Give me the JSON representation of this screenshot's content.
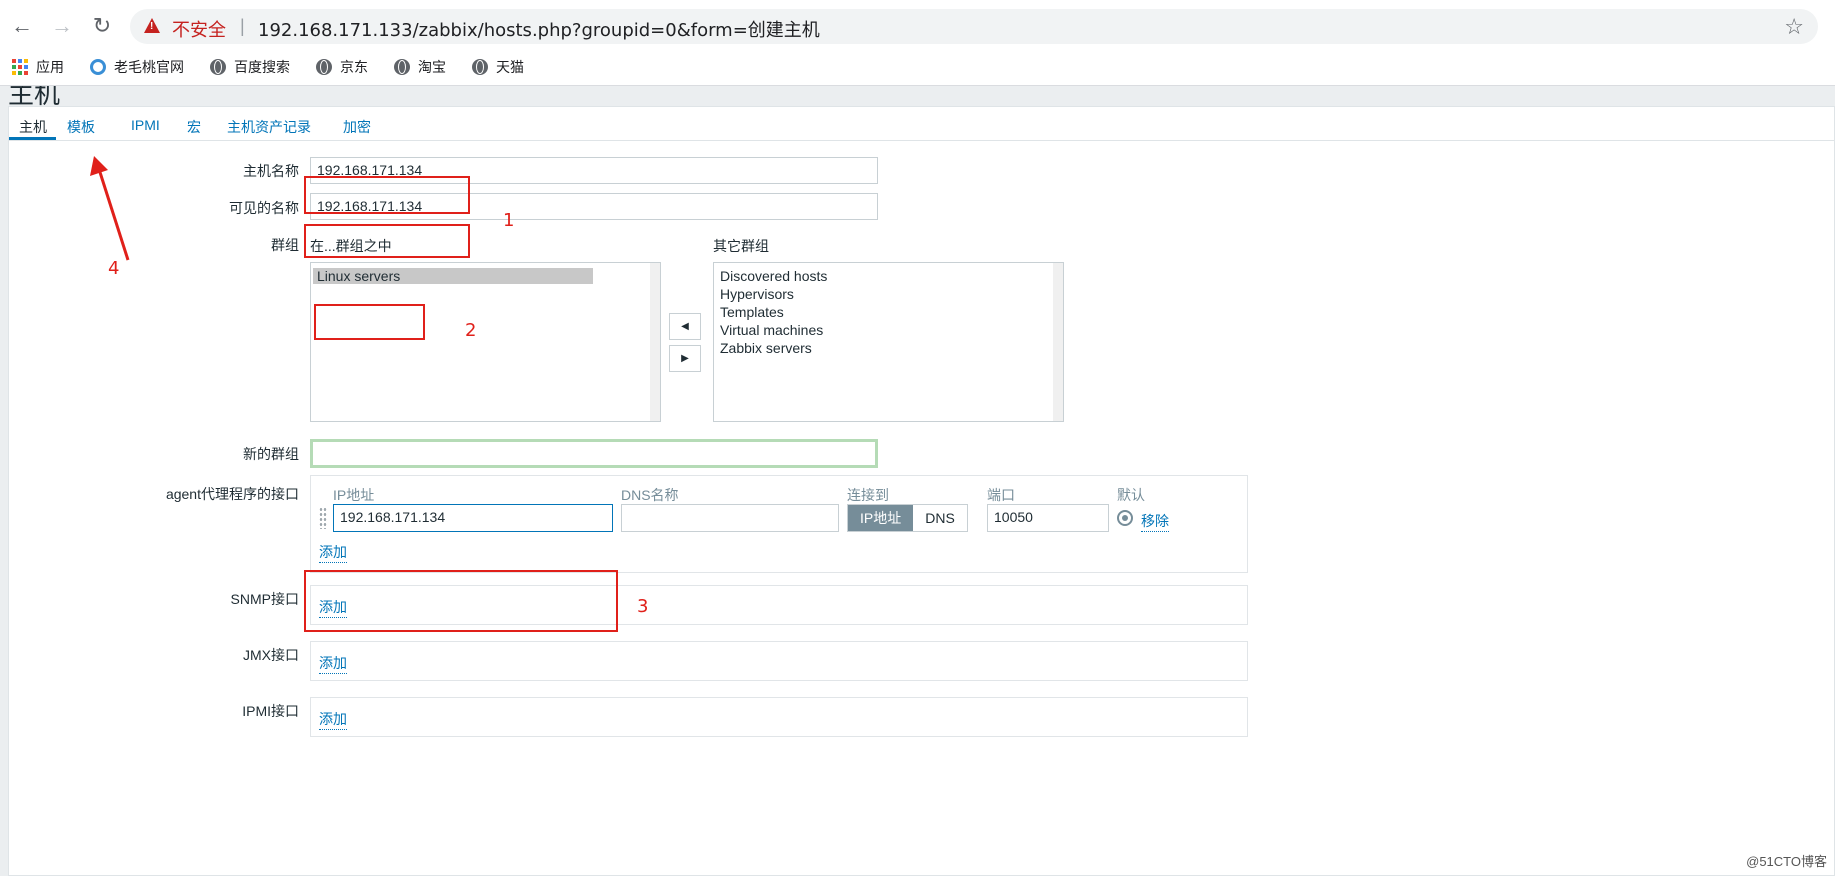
{
  "browser": {
    "back_glyph": "←",
    "forward_glyph": "→",
    "reload_glyph": "↻",
    "security_label": "不安全",
    "separator": "|",
    "url": "192.168.171.133/zabbix/hosts.php?groupid=0&form=创建主机",
    "star_glyph": "☆",
    "bookmarks": [
      {
        "label": "应用",
        "icon": "apps-grid-icon"
      },
      {
        "label": "老毛桃官网",
        "icon": "laomaotao-icon"
      },
      {
        "label": "百度搜索",
        "icon": "globe-icon"
      },
      {
        "label": "京东",
        "icon": "globe-icon"
      },
      {
        "label": "淘宝",
        "icon": "globe-icon"
      },
      {
        "label": "天猫",
        "icon": "globe-icon"
      }
    ]
  },
  "page": {
    "heading": "主机"
  },
  "tabs": [
    {
      "label": "主机",
      "active": true
    },
    {
      "label": "模板",
      "active": false
    },
    {
      "label": "IPMI",
      "active": false
    },
    {
      "label": "宏",
      "active": false
    },
    {
      "label": "主机资产记录",
      "active": false
    },
    {
      "label": "加密",
      "active": false
    }
  ],
  "form": {
    "host_name_label": "主机名称",
    "host_name_value": "192.168.171.134",
    "visible_name_label": "可见的名称",
    "visible_name_value": "192.168.171.134",
    "groups_label": "群组",
    "in_groups_label": "在...群组之中",
    "other_groups_label": "其它群组",
    "in_groups": [
      "Linux servers"
    ],
    "other_groups": [
      "Discovered hosts",
      "Hypervisors",
      "Templates",
      "Virtual machines",
      "Zabbix servers"
    ],
    "move_left_glyph": "◀",
    "move_right_glyph": "▶",
    "new_group_label": "新的群组",
    "new_group_value": "",
    "agent_label": "agent代理程序的接口",
    "agent_columns": {
      "ip": "IP地址",
      "dns": "DNS名称",
      "connect": "连接到",
      "port": "端口",
      "default": "默认"
    },
    "agent_ip_value": "192.168.171.134",
    "agent_dns_value": "",
    "connect_ip": "IP地址",
    "connect_dns": "DNS",
    "agent_port_value": "10050",
    "remove_label": "移除",
    "add_label": "添加",
    "snmp_label": "SNMP接口",
    "jmx_label": "JMX接口",
    "ipmi_label": "IPMI接口"
  },
  "annotations": {
    "n1": "1",
    "n2": "2",
    "n3": "3",
    "n4": "4"
  },
  "watermark": "@51CTO博客",
  "colors": {
    "link": "#0275b8",
    "annotation_red": "#e0201a",
    "insecure_red": "#c5221f"
  }
}
